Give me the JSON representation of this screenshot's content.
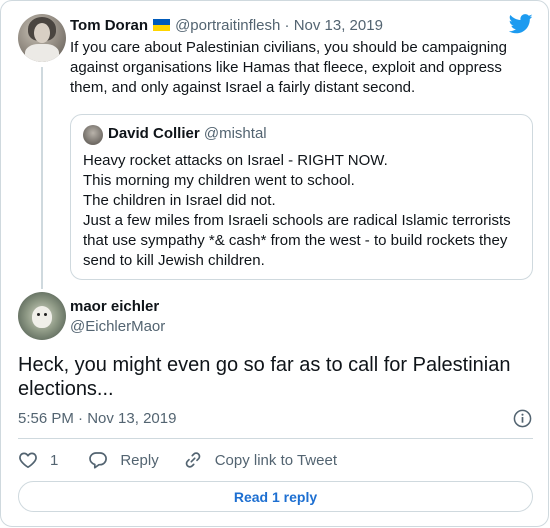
{
  "parent_tweet": {
    "author_name": "Tom Doran",
    "handle": "@portraitinflesh",
    "separator": "·",
    "date": "Nov 13, 2019",
    "avatar_caption": "",
    "text": "If you care about Palestinian civilians, you should be campaigning against organisations like Hamas that fleece, exploit and oppress them, and only against Israel a fairly distant second.",
    "flag_colors": [
      "#005bbb",
      "#ffd500"
    ]
  },
  "quoted_tweet": {
    "author_name": "David Collier",
    "handle": "@mishtal",
    "lines": [
      "Heavy rocket attacks on Israel - RIGHT NOW.",
      "This morning my children went to school.",
      "The children in Israel did not.",
      "Just a few miles from Israeli schools are radical Islamic terrorists that use sympathy *& cash* from the west - to build rockets they send to kill Jewish children."
    ]
  },
  "reply_tweet": {
    "author_name": "maor eichler",
    "handle": "@EichlerMaor",
    "text": "Heck, you might even go so far as to call for Palestinian elections...",
    "time": "5:56 PM",
    "separator": "·",
    "date": "Nov 13, 2019"
  },
  "actions": {
    "like_count": "1",
    "reply_label": "Reply",
    "copy_link_label": "Copy link to Tweet"
  },
  "read_replies_label": "Read 1 reply",
  "icons": {
    "brand": "twitter-bird-icon",
    "info": "info-icon",
    "like": "heart-icon",
    "reply": "speech-bubble-icon",
    "link": "link-icon"
  },
  "colors": {
    "brand_blue": "#1d9bf0",
    "link_blue": "#1d6fd1",
    "text": "#0f1419",
    "muted": "#536471",
    "border": "#cfd9de"
  }
}
